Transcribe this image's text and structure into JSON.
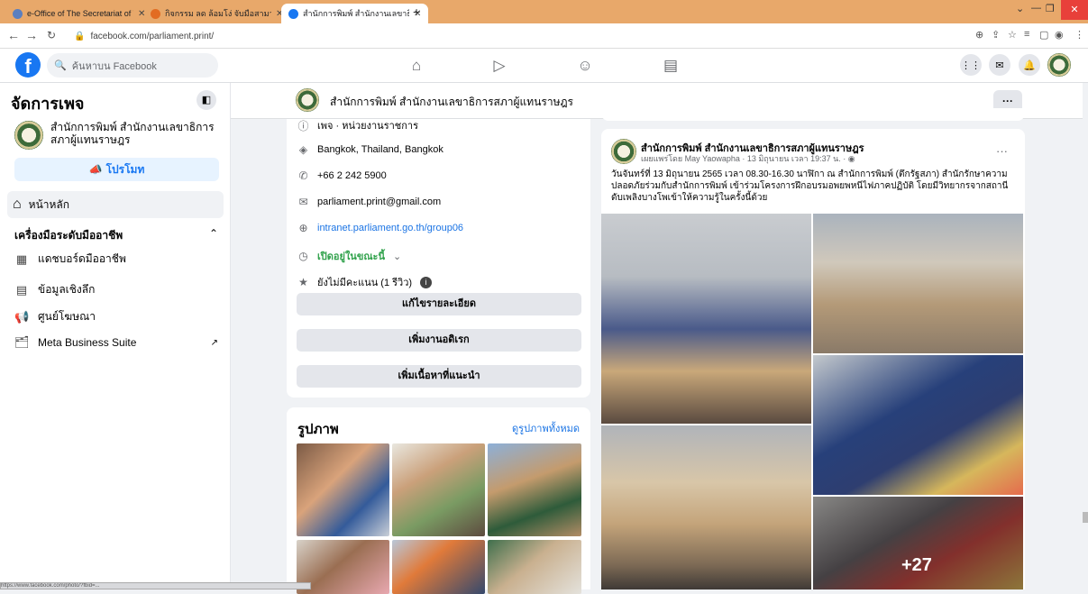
{
  "browser": {
    "tabs": [
      {
        "title": "e-Office of The Secretariat of The",
        "active": false,
        "icon_color": "#5b7fbf"
      },
      {
        "title": "กิจกรรม ลด ล้อมโง่ จับมือสามาทำหลวง",
        "active": false,
        "icon_color": "#e26c22"
      },
      {
        "title": "สำนักการพิมพ์ สำนักงานเลขาธิการ",
        "active": true,
        "icon_color": "#1877f2"
      }
    ],
    "new_tab": "+",
    "url": "facebook.com/parliament.print/"
  },
  "fb_nav": {
    "logo": "f",
    "search_placeholder": "ค้นหาบน Facebook"
  },
  "sidebar": {
    "title": "จัดการเพจ",
    "page_name": "สำนักการพิมพ์ สำนักงานเลขาธิการสภาผู้แทนราษฎร",
    "promote": "โปรโมท",
    "home": "หน้าหลัก",
    "professional_tools": "เครื่องมือระดับมืออาชีพ",
    "items": [
      {
        "label": "แดชบอร์ดมืออาชีพ",
        "icon": "dashboard-icon"
      },
      {
        "label": "ข้อมูลเชิงลึก",
        "icon": "insights-icon"
      },
      {
        "label": "ศูนย์โฆษณา",
        "icon": "ad-center-icon"
      },
      {
        "label": "Meta Business Suite",
        "icon": "business-suite-icon"
      }
    ]
  },
  "page_header": {
    "name": "สำนักการพิมพ์ สำนักงานเลขาธิการสภาผู้แทนราษฎร",
    "more": "···"
  },
  "about": {
    "category": "เพจ · หน่วยงานราชการ",
    "address": "Bangkok, Thailand, Bangkok",
    "phone": "+66 2 242 5900",
    "email": "parliament.print@gmail.com",
    "website": "intranet.parliament.go.th/group06",
    "hours": "เปิดอยู่ในขณะนี้",
    "rating": "ยังไม่มีคะแนน (1 รีวิว)",
    "buttons": [
      "แก้ไขรายละเอียด",
      "เพิ่มงานอดิเรก",
      "เพิ่มเนื้อหาที่แนะนำ"
    ]
  },
  "photos": {
    "title": "รูปภาพ",
    "see_all": "ดูรูปภาพทั้งหมด"
  },
  "post": {
    "author": "สำนักการพิมพ์ สำนักงานเลขาธิการสภาผู้แทนราษฎร",
    "meta": "เผยแพร่โดย May Yaowapha · 13 มิถุนายน เวลา 19:37 น. · ",
    "text": "วันจันทร์ที่ 13 มิถุนายน 2565 เวลา 08.30-16.30 นาฬิกา ณ สำนักการพิมพ์ (ตึกรัฐสภา) สำนักรักษาความปลอดภัยร่วมกับสำนักการพิมพ์ เข้าร่วมโครงการฝึกอบรมอพยพหนีไฟภาคปฏิบัติ โดยมีวิทยากรจากสถานีดับเพลิงบางโพเข้าให้ความรู้ในครั้งนี้ด้วย",
    "more_photos": "+27"
  },
  "status_bar": "https://www.facebook.com/photo/?fbid=..."
}
